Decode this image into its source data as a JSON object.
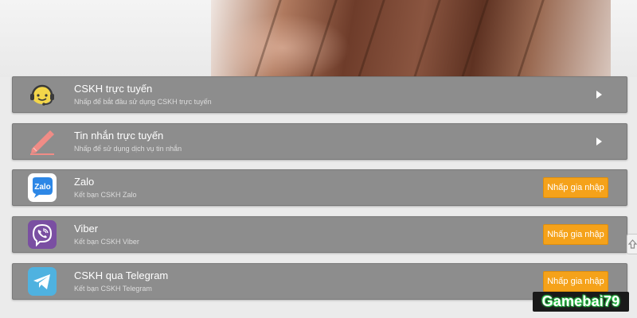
{
  "support_items": [
    {
      "title": "CSKH trực tuyến",
      "subtitle": "Nhấp để bắt đầu sử dụng CSKH trực tuyến",
      "icon": "headset-support-icon",
      "action": "arrow"
    },
    {
      "title": "Tin nhắn trực tuyến",
      "subtitle": "Nhấp để sử dụng dịch vụ tin nhắn",
      "icon": "pencil-message-icon",
      "action": "arrow"
    },
    {
      "title": "Zalo",
      "subtitle": "Kết bạn CSKH Zalo",
      "icon": "zalo-icon",
      "icon_text": "Zalo",
      "action": "button",
      "button_label": "Nhấp gia nhập"
    },
    {
      "title": "Viber",
      "subtitle": "Kết bạn CSKH Viber",
      "icon": "viber-icon",
      "action": "button",
      "button_label": "Nhấp gia nhập"
    },
    {
      "title": "CSKH qua Telegram",
      "subtitle": "Kết bạn CSKH Telegram",
      "icon": "telegram-icon",
      "action": "button",
      "button_label": "Nhấp gia nhập"
    }
  ],
  "watermark": "Gamebai79",
  "colors": {
    "row_bg": "#8d8d8d",
    "button_bg": "#f5a21a",
    "page_bg": "#ebebeb",
    "viber": "#7a4fa2",
    "telegram": "#4fb2e0",
    "zalo": "#2d87e6",
    "headset": "#f3d64a",
    "pencil": "#f08c86"
  }
}
